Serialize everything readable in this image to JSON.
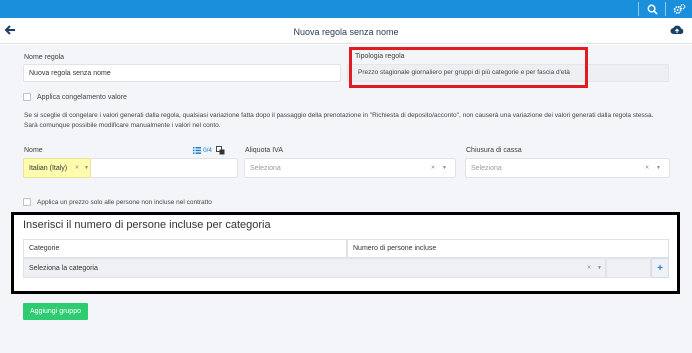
{
  "header": {
    "title": "Nuova regola senza nome",
    "search_icon": "search-icon",
    "settings_icon": "gears-icon",
    "back_icon": "arrow-left-icon",
    "cloud_icon": "cloud-upload-icon"
  },
  "form": {
    "rule_name_label": "Nome regola",
    "rule_name_value": "Nuova regola senza nome",
    "rule_type_label": "Tipologia regola",
    "rule_type_value": "Prezzo stagionale giornaliero per gruppi di più categorie e per fascia d'età",
    "freeze_label": "Applica congelamento valore",
    "freeze_note_1": "Se si sceglie di congelare i valori generati dalla regola, qualsiasi variazione fatta dopo il passaggio della prenotazione in \"Richiesta di deposito/acconto\", non causerà una variazione dei valori generati dalla regola stessa.",
    "freeze_note_2": "Sarà comunque possibile modificare manualmente i valori nel conto.",
    "name_label": "Nome",
    "name_lang_counter": "0/4",
    "name_lang_value": "Italian (Italy)",
    "vat_label": "Aliquota IVA",
    "vat_placeholder": "Seleziona",
    "cash_label": "Chiusura di cassa",
    "cash_placeholder": "Seleziona",
    "not_included_label": "Applica un prezzo solo alle persone non incluse nel contratto"
  },
  "persons": {
    "heading": "Inserisci il numero di persone incluse per categoria",
    "col_category": "Categorie",
    "col_number": "Numero di persone incluse",
    "category_placeholder": "Seleziona la categoria"
  },
  "actions": {
    "add_group": "Aggiungi gruppo"
  },
  "colors": {
    "topbar": "#1a8fdc",
    "highlight_red": "#e11b22",
    "add_button": "#2ecc71",
    "language_field": "#fffcae"
  }
}
